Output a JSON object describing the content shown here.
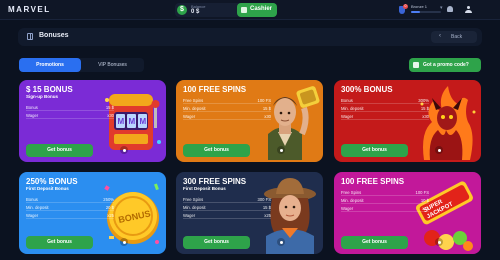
{
  "header": {
    "logo": "MARVEL",
    "balance_label": "Balance",
    "balance_value": "0 $",
    "cashier_label": "Cashier",
    "notifications_count": "0",
    "level_label": "Bronze 1",
    "level_progress": 0.3
  },
  "page": {
    "title": "Bonuses",
    "back_label": "Back"
  },
  "tabs": [
    {
      "label": "Promotions",
      "active": true
    },
    {
      "label": "VIP Bonuses",
      "active": false
    }
  ],
  "promo_button_label": "Got a promo code?",
  "cards": [
    {
      "title": "$ 15 BONUS",
      "subtitle": "Sign-up Bonus",
      "rows": [
        {
          "k": "Bonus",
          "v": "15 $"
        },
        {
          "k": "Wager",
          "v": "x30"
        }
      ],
      "button": "Get bonus",
      "bg": "#7b2bd6",
      "art": "slot-machine"
    },
    {
      "title": "100 FREE SPINS",
      "subtitle": "",
      "rows": [
        {
          "k": "Free Spins",
          "v": "100 FS"
        },
        {
          "k": "Min. deposit",
          "v": "15 $"
        },
        {
          "k": "Wager",
          "v": "x30"
        }
      ],
      "button": "Get bonus",
      "bg": "#e07a15",
      "art": "adventurer-man"
    },
    {
      "title": "300% BONUS",
      "subtitle": "",
      "rows": [
        {
          "k": "Bonus",
          "v": "300%"
        },
        {
          "k": "Min. deposit",
          "v": "15 $"
        },
        {
          "k": "Wager",
          "v": "x30"
        }
      ],
      "button": "Get bonus",
      "bg": "#c41a1a",
      "art": "fire-demon"
    },
    {
      "title": "250% BONUS",
      "subtitle": "First Deposit Bonus",
      "rows": [
        {
          "k": "Bonus",
          "v": "250%"
        },
        {
          "k": "Min. deposit",
          "v": "20 $"
        },
        {
          "k": "Wager",
          "v": "x25"
        }
      ],
      "button": "Get bonus",
      "bg": "#2b8ef0",
      "art": "gold-coin"
    },
    {
      "title": "300 FREE SPINS",
      "subtitle": "First Deposit Bonus",
      "rows": [
        {
          "k": "Free Spins",
          "v": "300 FS"
        },
        {
          "k": "Min. deposit",
          "v": "15 $"
        },
        {
          "k": "Wager",
          "v": "x25"
        }
      ],
      "button": "Get bonus",
      "bg": "#1f2d4d",
      "art": "adventurer-woman"
    },
    {
      "title": "100 FREE SPINS",
      "subtitle": "",
      "rows": [
        {
          "k": "Free Spins",
          "v": "100 FS"
        },
        {
          "k": "Min. deposit",
          "v": "10 $"
        },
        {
          "k": "Wager",
          "v": "x25"
        }
      ],
      "button": "Get bonus",
      "bg": "#c2189a",
      "art": "super-jackpot"
    }
  ],
  "colors": {
    "background": "#0b1220",
    "accent_green": "#2ea34a",
    "accent_blue": "#2a6ff0"
  }
}
